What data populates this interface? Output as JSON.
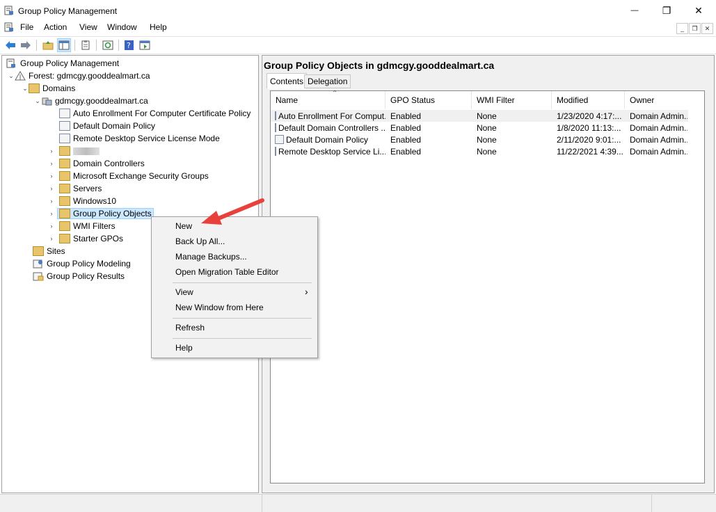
{
  "window": {
    "title": "Group Policy Management",
    "controls": {
      "minimize": "—",
      "restore": "❐",
      "close": "✕"
    }
  },
  "menubar": {
    "items": [
      "File",
      "Action",
      "View",
      "Window",
      "Help"
    ],
    "mdi": {
      "minimize": "_",
      "restore": "❐",
      "close": "✕"
    }
  },
  "tree": {
    "root": "Group Policy Management",
    "forest": "Forest: gdmcgy.gooddealmart.ca",
    "domains": "Domains",
    "domain": "gdmcgy.gooddealmart.ca",
    "links": [
      "Auto Enrollment For Computer Certificate Policy",
      "Default Domain Policy",
      "Remote Desktop Service License Mode"
    ],
    "ous": [
      "Domain Controllers",
      "Microsoft Exchange Security Groups",
      "Servers",
      "Windows10"
    ],
    "gpo_container": "Group Policy Objects",
    "wmi": "WMI Filters",
    "starter": "Starter GPOs",
    "sites": "Sites",
    "modeling": "Group Policy Modeling",
    "results": "Group Policy Results"
  },
  "right": {
    "title": "Group Policy Objects in gdmcgy.gooddealmart.ca",
    "tabs": [
      "Contents",
      "Delegation"
    ],
    "columns": [
      "Name",
      "GPO Status",
      "WMI Filter",
      "Modified",
      "Owner"
    ],
    "rows": [
      [
        "Auto Enrollment For Comput...",
        "Enabled",
        "None",
        "1/23/2020 4:17:...",
        "Domain Admin..."
      ],
      [
        "Default Domain Controllers ...",
        "Enabled",
        "None",
        "1/8/2020 11:13:...",
        "Domain Admin..."
      ],
      [
        "Default Domain Policy",
        "Enabled",
        "None",
        "2/11/2020 9:01:...",
        "Domain Admin..."
      ],
      [
        "Remote Desktop Service Li...",
        "Enabled",
        "None",
        "11/22/2021 4:39...",
        "Domain Admin..."
      ]
    ]
  },
  "context_menu": {
    "items": [
      "New",
      "Back Up All...",
      "Manage Backups...",
      "Open Migration Table Editor",
      "View",
      "New Window from Here",
      "Refresh",
      "Help"
    ],
    "submenu_arrow": "›"
  },
  "colors": {
    "selection": "#cce8ff",
    "arrow": "#e8413c",
    "folder": "#e8c56a"
  }
}
